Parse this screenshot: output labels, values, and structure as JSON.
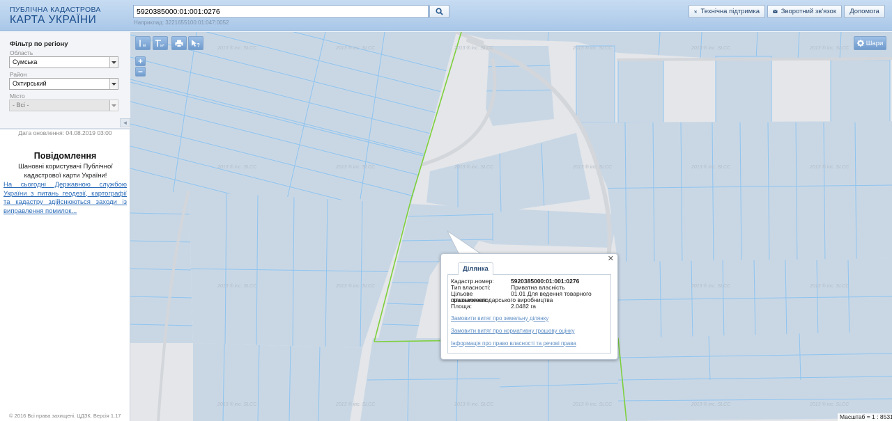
{
  "app": {
    "logo_top": "ПУБЛІЧНА КАДАСТРОВА",
    "logo_bottom": "КАРТА УКРАЇНИ"
  },
  "search": {
    "value": "5920385000:01:001:0276",
    "hint": "Наприклад: 3221655100:01:047:0052",
    "button_icon": "search-icon"
  },
  "header_buttons": {
    "support": "Технічна підтримка",
    "feedback": "Зворотний зв'язок",
    "help": "Допомога"
  },
  "filter": {
    "title": "Фільтр по регіону",
    "region_label": "Область",
    "region_value": "Сумська",
    "district_label": "Район",
    "district_value": "Охтирський",
    "city_label": "Місто",
    "city_value": "- Всі -"
  },
  "update_date": "Дата оновлення: 04.08.2019 03:00",
  "notice": {
    "title": "Повідомлення",
    "body": "Шановні користувачі Публічної кадастрової карти України!",
    "link": "На сьогодні Державною службою України з питань геодезії, картографії та кадастру здійснюються заходи із виправлення помилок..."
  },
  "footer": "© 2016 Всі права захищені. ЦДЗК. Версія 1.17",
  "map": {
    "layers_label": "Шари",
    "zoom_in": "+",
    "zoom_out": "−",
    "scale_label": "Масштаб = 1 : 8531",
    "watermark": "2013 ® inc. SLCC",
    "colors": {
      "background": "#e4e6e9",
      "parcel_fill": "#c9d7e5",
      "parcel_border": "#8ec4ef",
      "boundary": "#7ed03c",
      "road": "#d3d6da"
    }
  },
  "popup": {
    "tab": "Ділянка",
    "rows": [
      {
        "label": "Кадастр.номер:",
        "value": "5920385000:01:001:0276",
        "bold": true
      },
      {
        "label": "Тип власності:",
        "value": "Приватна власність"
      },
      {
        "label": "Цільове призначення:",
        "value": "01.01 Для ведення товарного",
        "wrap": "сільськогосподарського виробництва"
      },
      {
        "label": "Площа:",
        "value": "2.0482 га"
      }
    ],
    "links": [
      "Замовити витяг про земельну ділянку",
      "Замовити витяг про нормативну грошову оцінку",
      "Інформація про право власності та речові права"
    ]
  }
}
